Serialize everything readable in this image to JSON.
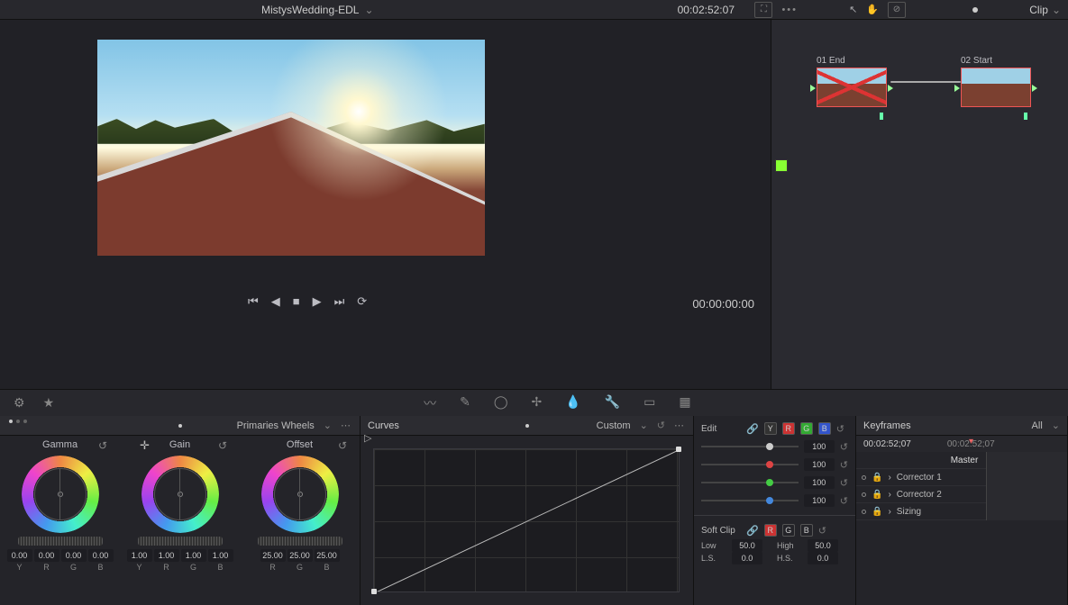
{
  "topbar": {
    "project": "MistysWedding-EDL",
    "timecode": "00:02:52:07",
    "clip_label": "Clip"
  },
  "viewer": {
    "position_tc": "00:00:00:00"
  },
  "nodes": {
    "n1": {
      "index": "01",
      "name": "End"
    },
    "n2": {
      "index": "02",
      "name": "Start"
    }
  },
  "wheels": {
    "mode": "Primaries Wheels",
    "cols": [
      {
        "label": "Gamma",
        "vals": [
          "0.00",
          "0.00",
          "0.00",
          "0.00"
        ],
        "ch": [
          "Y",
          "R",
          "G",
          "B"
        ]
      },
      {
        "label": "Gain",
        "vals": [
          "1.00",
          "1.00",
          "1.00",
          "1.00"
        ],
        "ch": [
          "Y",
          "R",
          "G",
          "B"
        ]
      },
      {
        "label": "Offset",
        "vals": [
          "25.00",
          "25.00",
          "25.00"
        ],
        "ch": [
          "R",
          "G",
          "B"
        ]
      }
    ]
  },
  "curves": {
    "title": "Curves",
    "mode": "Custom"
  },
  "edit": {
    "label": "Edit",
    "vals": {
      "y": "100",
      "r": "100",
      "g": "100",
      "b": "100"
    },
    "softclip": {
      "label": "Soft Clip",
      "low_lbl": "Low",
      "low": "50.0",
      "high_lbl": "High",
      "high": "50.0",
      "ls_lbl": "L.S.",
      "ls": "0.0",
      "hs_lbl": "H.S.",
      "hs": "0.0"
    }
  },
  "keyframes": {
    "title": "Keyframes",
    "filter": "All",
    "tc_left": "00:02:52;07",
    "tc_right": "00:02:52;07",
    "master": "Master",
    "tracks": [
      "Corrector 1",
      "Corrector 2",
      "Sizing"
    ]
  }
}
